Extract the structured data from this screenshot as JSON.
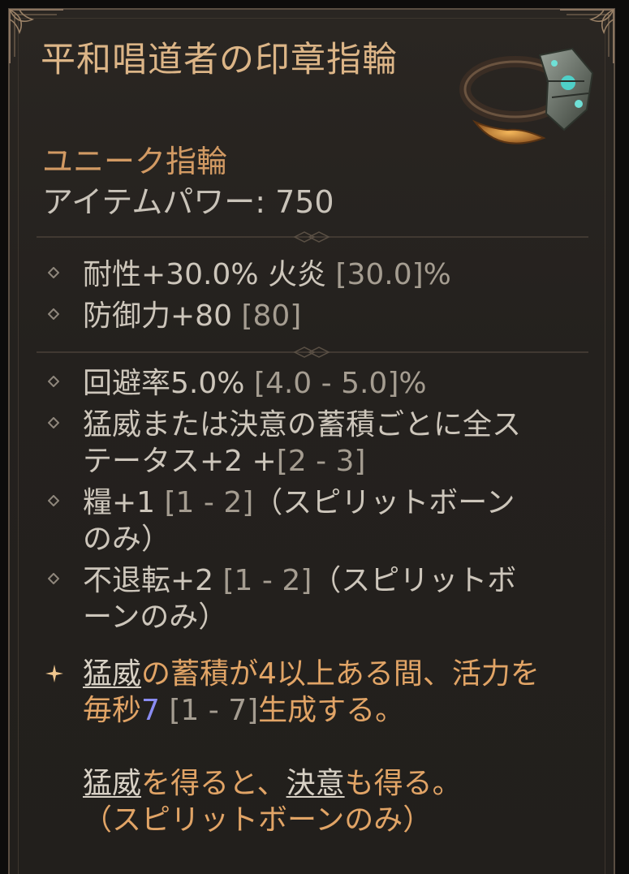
{
  "item": {
    "name": "平和唱道者の印章指輪",
    "rarity": "ユニーク指輪",
    "power_label": "アイテムパワー: 750"
  },
  "implicit_stats": [
    {
      "text": "耐性+30.0% 火炎 ",
      "range": "[30.0]%"
    },
    {
      "text": "防御力+80 ",
      "range": "[80]"
    }
  ],
  "affixes": [
    {
      "text": "回避率5.0% ",
      "range": "[4.0 - 5.0]%",
      "cont": ""
    },
    {
      "text": "猛威または決意の蓄積ごとに全ステータス+2 +",
      "range": "[2 - 3]",
      "cont": ""
    },
    {
      "text": "糧+1 ",
      "range": "[1 - 2]",
      "cont": "（スピリットボーンのみ）"
    },
    {
      "text": "不退転+2 ",
      "range": "[1 - 2]",
      "cont": "（スピリットボーンのみ）"
    }
  ],
  "unique_power": {
    "kw1": "猛威",
    "p1": "の蓄積が4以上ある間、活力を毎秒",
    "value": "7",
    "range": " [1 - 7]",
    "p2": "生成する。",
    "kw2": "猛威",
    "p3": "を得ると、",
    "kw3": "決意",
    "p4": "も得る。",
    "p5": "（スピリットボーンのみ）"
  },
  "colors": {
    "name": "#dcb587",
    "rarity": "#d29a63",
    "text": "#cdc6bb",
    "unique": "#e1a466",
    "value_highlight": "#8a8cf2"
  },
  "icons": [
    "ornate-corner-icon",
    "ring-icon",
    "diamond-bullet-icon",
    "star-bullet-icon"
  ]
}
